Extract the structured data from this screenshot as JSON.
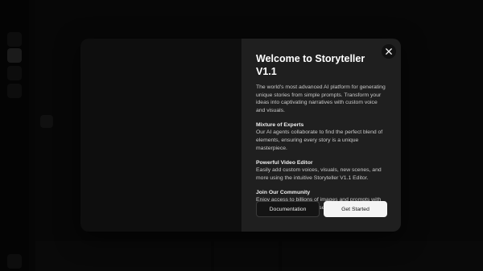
{
  "modal": {
    "title": "Welcome to Storyteller V1.1",
    "intro": "The world's most advanced AI platform for generating unique stories from simple prompts. Transform your ideas into captivating narratives with custom voice and visuals.",
    "features": [
      {
        "title": "Mixture of Experts",
        "description": "Our AI agents collaborate to find the perfect blend of elements, ensuring every story is a unique masterpiece."
      },
      {
        "title": "Powerful Video Editor",
        "description": "Easily add custom voices, visuals, new scenes, and more using the intuitive Storyteller V1.1 Editor."
      },
      {
        "title": "Join Our Community",
        "description": "Enjoy access to billions of images and prompts with daily trends and real-time search."
      }
    ],
    "buttons": {
      "documentation": "Documentation",
      "get_started": "Get Started"
    },
    "close_icon": "close-icon"
  },
  "colors": {
    "modal_content_bg": "#1f1f1f",
    "modal_media_bg": "#0e0e0e",
    "primary_button_bg": "#f4f4f4",
    "secondary_button_bg": "#141414"
  }
}
